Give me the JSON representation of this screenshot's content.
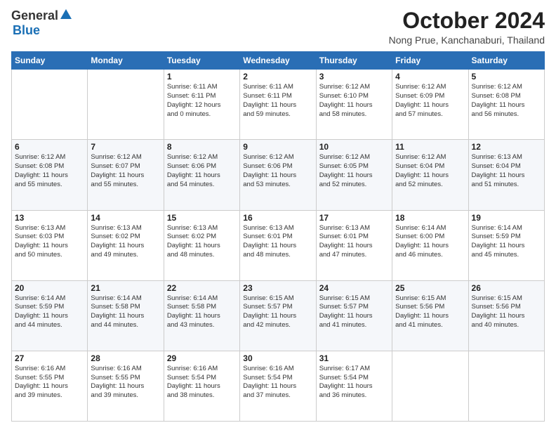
{
  "logo": {
    "general": "General",
    "blue": "Blue"
  },
  "title": "October 2024",
  "location": "Nong Prue, Kanchanaburi, Thailand",
  "headers": [
    "Sunday",
    "Monday",
    "Tuesday",
    "Wednesday",
    "Thursday",
    "Friday",
    "Saturday"
  ],
  "weeks": [
    [
      {
        "day": "",
        "info": ""
      },
      {
        "day": "",
        "info": ""
      },
      {
        "day": "1",
        "info": "Sunrise: 6:11 AM\nSunset: 6:11 PM\nDaylight: 12 hours\nand 0 minutes."
      },
      {
        "day": "2",
        "info": "Sunrise: 6:11 AM\nSunset: 6:11 PM\nDaylight: 11 hours\nand 59 minutes."
      },
      {
        "day": "3",
        "info": "Sunrise: 6:12 AM\nSunset: 6:10 PM\nDaylight: 11 hours\nand 58 minutes."
      },
      {
        "day": "4",
        "info": "Sunrise: 6:12 AM\nSunset: 6:09 PM\nDaylight: 11 hours\nand 57 minutes."
      },
      {
        "day": "5",
        "info": "Sunrise: 6:12 AM\nSunset: 6:08 PM\nDaylight: 11 hours\nand 56 minutes."
      }
    ],
    [
      {
        "day": "6",
        "info": "Sunrise: 6:12 AM\nSunset: 6:08 PM\nDaylight: 11 hours\nand 55 minutes."
      },
      {
        "day": "7",
        "info": "Sunrise: 6:12 AM\nSunset: 6:07 PM\nDaylight: 11 hours\nand 55 minutes."
      },
      {
        "day": "8",
        "info": "Sunrise: 6:12 AM\nSunset: 6:06 PM\nDaylight: 11 hours\nand 54 minutes."
      },
      {
        "day": "9",
        "info": "Sunrise: 6:12 AM\nSunset: 6:06 PM\nDaylight: 11 hours\nand 53 minutes."
      },
      {
        "day": "10",
        "info": "Sunrise: 6:12 AM\nSunset: 6:05 PM\nDaylight: 11 hours\nand 52 minutes."
      },
      {
        "day": "11",
        "info": "Sunrise: 6:12 AM\nSunset: 6:04 PM\nDaylight: 11 hours\nand 52 minutes."
      },
      {
        "day": "12",
        "info": "Sunrise: 6:13 AM\nSunset: 6:04 PM\nDaylight: 11 hours\nand 51 minutes."
      }
    ],
    [
      {
        "day": "13",
        "info": "Sunrise: 6:13 AM\nSunset: 6:03 PM\nDaylight: 11 hours\nand 50 minutes."
      },
      {
        "day": "14",
        "info": "Sunrise: 6:13 AM\nSunset: 6:02 PM\nDaylight: 11 hours\nand 49 minutes."
      },
      {
        "day": "15",
        "info": "Sunrise: 6:13 AM\nSunset: 6:02 PM\nDaylight: 11 hours\nand 48 minutes."
      },
      {
        "day": "16",
        "info": "Sunrise: 6:13 AM\nSunset: 6:01 PM\nDaylight: 11 hours\nand 48 minutes."
      },
      {
        "day": "17",
        "info": "Sunrise: 6:13 AM\nSunset: 6:01 PM\nDaylight: 11 hours\nand 47 minutes."
      },
      {
        "day": "18",
        "info": "Sunrise: 6:14 AM\nSunset: 6:00 PM\nDaylight: 11 hours\nand 46 minutes."
      },
      {
        "day": "19",
        "info": "Sunrise: 6:14 AM\nSunset: 5:59 PM\nDaylight: 11 hours\nand 45 minutes."
      }
    ],
    [
      {
        "day": "20",
        "info": "Sunrise: 6:14 AM\nSunset: 5:59 PM\nDaylight: 11 hours\nand 44 minutes."
      },
      {
        "day": "21",
        "info": "Sunrise: 6:14 AM\nSunset: 5:58 PM\nDaylight: 11 hours\nand 44 minutes."
      },
      {
        "day": "22",
        "info": "Sunrise: 6:14 AM\nSunset: 5:58 PM\nDaylight: 11 hours\nand 43 minutes."
      },
      {
        "day": "23",
        "info": "Sunrise: 6:15 AM\nSunset: 5:57 PM\nDaylight: 11 hours\nand 42 minutes."
      },
      {
        "day": "24",
        "info": "Sunrise: 6:15 AM\nSunset: 5:57 PM\nDaylight: 11 hours\nand 41 minutes."
      },
      {
        "day": "25",
        "info": "Sunrise: 6:15 AM\nSunset: 5:56 PM\nDaylight: 11 hours\nand 41 minutes."
      },
      {
        "day": "26",
        "info": "Sunrise: 6:15 AM\nSunset: 5:56 PM\nDaylight: 11 hours\nand 40 minutes."
      }
    ],
    [
      {
        "day": "27",
        "info": "Sunrise: 6:16 AM\nSunset: 5:55 PM\nDaylight: 11 hours\nand 39 minutes."
      },
      {
        "day": "28",
        "info": "Sunrise: 6:16 AM\nSunset: 5:55 PM\nDaylight: 11 hours\nand 39 minutes."
      },
      {
        "day": "29",
        "info": "Sunrise: 6:16 AM\nSunset: 5:54 PM\nDaylight: 11 hours\nand 38 minutes."
      },
      {
        "day": "30",
        "info": "Sunrise: 6:16 AM\nSunset: 5:54 PM\nDaylight: 11 hours\nand 37 minutes."
      },
      {
        "day": "31",
        "info": "Sunrise: 6:17 AM\nSunset: 5:54 PM\nDaylight: 11 hours\nand 36 minutes."
      },
      {
        "day": "",
        "info": ""
      },
      {
        "day": "",
        "info": ""
      }
    ]
  ]
}
